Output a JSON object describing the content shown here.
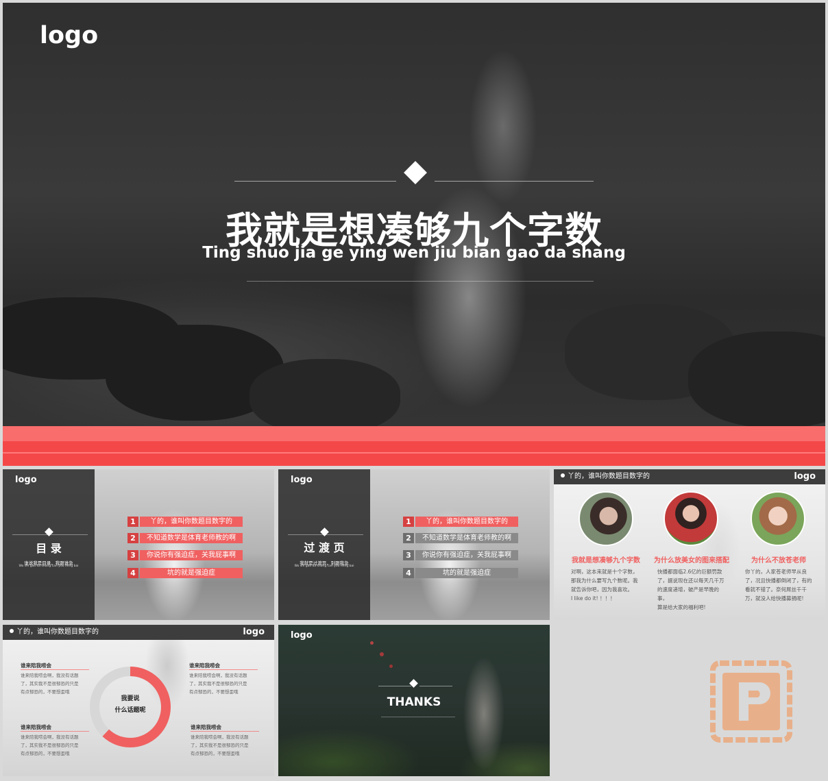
{
  "hero": {
    "logo": "logo",
    "title": "我就是想凑够九个字数",
    "subtitle": "Ting shuo jia ge ying wen jiu bian gao da shang"
  },
  "slide_toc": {
    "logo": "logo",
    "heading": "目 录",
    "caption": "谁说我是目录，我跟谁急",
    "caption_en": "Wo shi gao da shang can you ming bai",
    "items": [
      {
        "num": "1",
        "text": "丫的，谁叫你数题目数字的"
      },
      {
        "num": "2",
        "text": "不知道数学是体育老师教的啊"
      },
      {
        "num": "3",
        "text": "你说你有强迫症，关我屁事啊"
      },
      {
        "num": "4",
        "text": "坑的就是强迫症"
      }
    ],
    "accent": "#f06060"
  },
  "slide_transition": {
    "logo": "logo",
    "heading": "过 渡 页",
    "caption": "我就是过渡页，别跟我急",
    "caption_en": "Wo shi gao da shang can you ming bai",
    "items": [
      {
        "num": "1",
        "text": "丫的，谁叫你数题目数字的"
      },
      {
        "num": "2",
        "text": "不知道数学是体育老师教的啊"
      },
      {
        "num": "3",
        "text": "你说你有强迫症，关我屁事啊"
      },
      {
        "num": "4",
        "text": "坑的就是强迫症"
      }
    ]
  },
  "slide_three": {
    "topbar": "丫的，谁叫你数题目数字的",
    "logo": "logo",
    "columns": [
      {
        "title": "我就是想凑够九个字数",
        "lines": [
          "对啊，这本来就是十个字数，",
          "那我为什么要写九个数呢。我",
          "就告诉你吧，因为我喜欢。",
          "I like do it! ！！！"
        ]
      },
      {
        "title": "为什么放美女的图来搭配",
        "lines": [
          "快播都面临2.6亿的巨额罚款",
          "了，据说现在还以每天几千万",
          "的速度递增，破产是早晚的",
          "事，",
          "算是给大家的福利吧!"
        ]
      },
      {
        "title": "为什么不放苍老师",
        "lines": [
          "你丫的，人家苍老师早从良",
          "了，况且快播都倒闭了，有的",
          "看就不错了。奈何屌丝千千",
          "万，就没人给快播募捐呢!"
        ]
      }
    ]
  },
  "slide_ring": {
    "topbar": "丫的，谁叫你数题目数字的",
    "logo": "logo",
    "center": [
      "我要说",
      "什么话题呢"
    ],
    "blocks": [
      {
        "label": "谁来陪我唠会",
        "lines": [
          "谁来陪我唠会啊，我没有话题",
          "了，其实我不是很郁恐的只是",
          "有点郁恐的，不要想歪哦"
        ]
      },
      {
        "label": "谁来陪我唠会",
        "lines": [
          "谁来陪我唠会啊，我没有话题",
          "了，其实我不是很郁恐的只是",
          "有点郁恐的，不要想歪哦"
        ]
      },
      {
        "label": "谁来陪我唠会",
        "lines": [
          "谁来陪我唠会啊，我没有话题",
          "了，其实我不是很郁恐的只是",
          "有点郁恐的，不要想歪哦"
        ]
      },
      {
        "label": "谁来陪我唠会",
        "lines": [
          "谁来陪我唠会啊，我没有话题",
          "了，其实我不是很郁恐的只是",
          "有点郁恐的，不要想歪哦"
        ]
      }
    ],
    "ring_share": 0.62
  },
  "slide_thanks": {
    "logo": "logo",
    "text": "THANKS"
  },
  "colors": {
    "accent": "#f06060",
    "band_light": "#f96d6d",
    "band_dark": "#f44848",
    "topbar": "#3d3d3d"
  }
}
